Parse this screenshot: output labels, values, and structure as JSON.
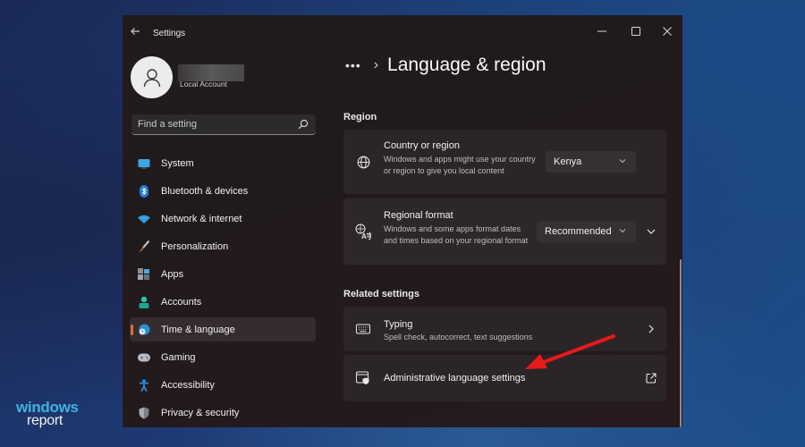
{
  "window": {
    "app_title": "Settings",
    "back_icon": "back-arrow-icon",
    "controls": {
      "minimize": "minimize-icon",
      "maximize": "maximize-icon",
      "close": "close-icon"
    }
  },
  "account": {
    "name": "[redacted]",
    "subtitle": "Local Account"
  },
  "search": {
    "placeholder": "Find a setting",
    "value": ""
  },
  "sidebar": {
    "items": [
      {
        "label": "System",
        "icon": "monitor-icon",
        "selected": false
      },
      {
        "label": "Bluetooth & devices",
        "icon": "bluetooth-icon",
        "selected": false
      },
      {
        "label": "Network & internet",
        "icon": "wifi-icon",
        "selected": false
      },
      {
        "label": "Personalization",
        "icon": "paintbrush-icon",
        "selected": false
      },
      {
        "label": "Apps",
        "icon": "apps-icon",
        "selected": false
      },
      {
        "label": "Accounts",
        "icon": "person-icon",
        "selected": false
      },
      {
        "label": "Time & language",
        "icon": "globe-clock-icon",
        "selected": true
      },
      {
        "label": "Gaming",
        "icon": "gamepad-icon",
        "selected": false
      },
      {
        "label": "Accessibility",
        "icon": "accessibility-icon",
        "selected": false
      },
      {
        "label": "Privacy & security",
        "icon": "shield-icon",
        "selected": false
      }
    ],
    "accent_color": "#e06a4a"
  },
  "main": {
    "breadcrumb_more": "•••",
    "breadcrumb_sep": "›",
    "title": "Language & region",
    "sections": {
      "region": {
        "label": "Region",
        "country": {
          "title": "Country or region",
          "description": "Windows and apps might use your country or region to give you local content",
          "value": "Kenya"
        },
        "format": {
          "title": "Regional format",
          "description": "Windows and some apps format dates and times based on your regional format",
          "value": "Recommended"
        }
      },
      "related": {
        "label": "Related settings",
        "typing": {
          "title": "Typing",
          "description": "Spell check, autocorrect, text suggestions"
        },
        "admin": {
          "title": "Administrative language settings"
        }
      }
    }
  },
  "annotation": {
    "type": "arrow",
    "color": "#e8191b",
    "points_to": "Administrative language settings"
  },
  "watermark": {
    "line1": "windows",
    "line2": "report"
  }
}
